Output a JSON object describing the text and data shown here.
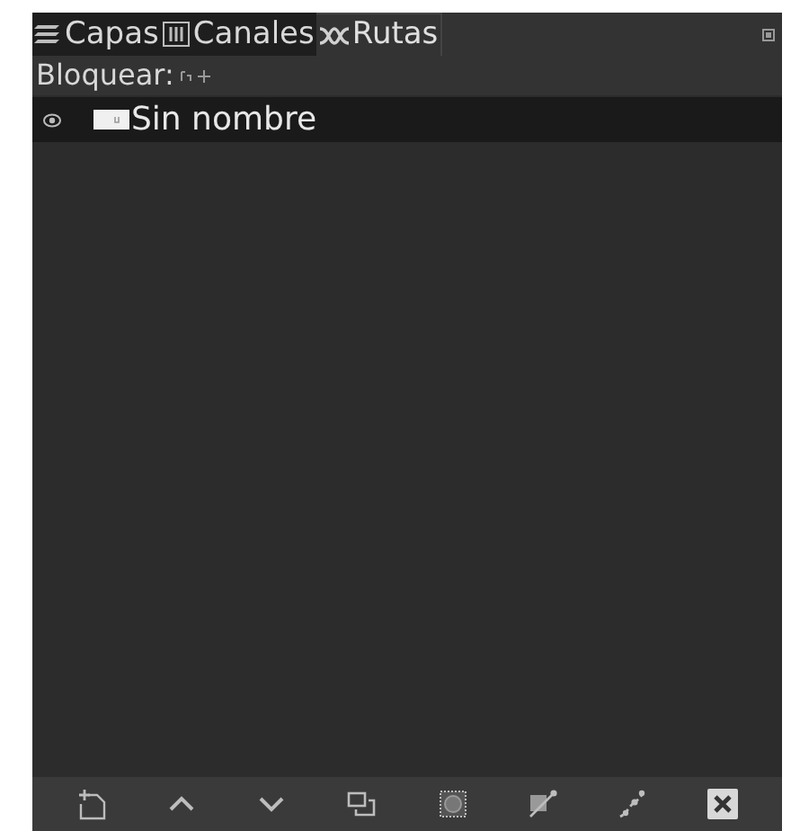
{
  "tabs": [
    {
      "label": "Capas",
      "kind": "layers",
      "selected": false
    },
    {
      "label": "Canales",
      "kind": "channels",
      "selected": false
    },
    {
      "label": "Rutas",
      "kind": "paths",
      "selected": true
    }
  ],
  "lock": {
    "label": "Bloquear:"
  },
  "paths": [
    {
      "name": "Sin nombre",
      "visible": true,
      "selected": true
    }
  ],
  "toolbar": [
    {
      "kind": "new"
    },
    {
      "kind": "up"
    },
    {
      "kind": "down"
    },
    {
      "kind": "duplicate"
    },
    {
      "kind": "to-selection"
    },
    {
      "kind": "edit"
    },
    {
      "kind": "stroke"
    },
    {
      "kind": "delete"
    }
  ]
}
